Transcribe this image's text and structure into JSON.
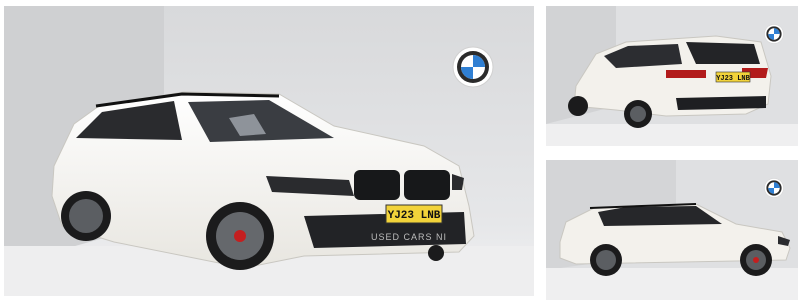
{
  "gallery": {
    "main_photo": {
      "plate_text": "YJ23 LNB",
      "watermark_text": "USED CARS NI",
      "brand_logo": "bmw-logo"
    },
    "rear_photo": {
      "plate_text": "YJ23 LNB",
      "brand_logo": "bmw-logo"
    },
    "side_photo": {
      "brand_logo": "bmw-logo"
    }
  },
  "colors": {
    "studio_background": "#dfe0e2",
    "car_body": "#f3f1ec",
    "bmw_blue": "#2f7fd3",
    "plate_yellow": "#f2d33a"
  }
}
